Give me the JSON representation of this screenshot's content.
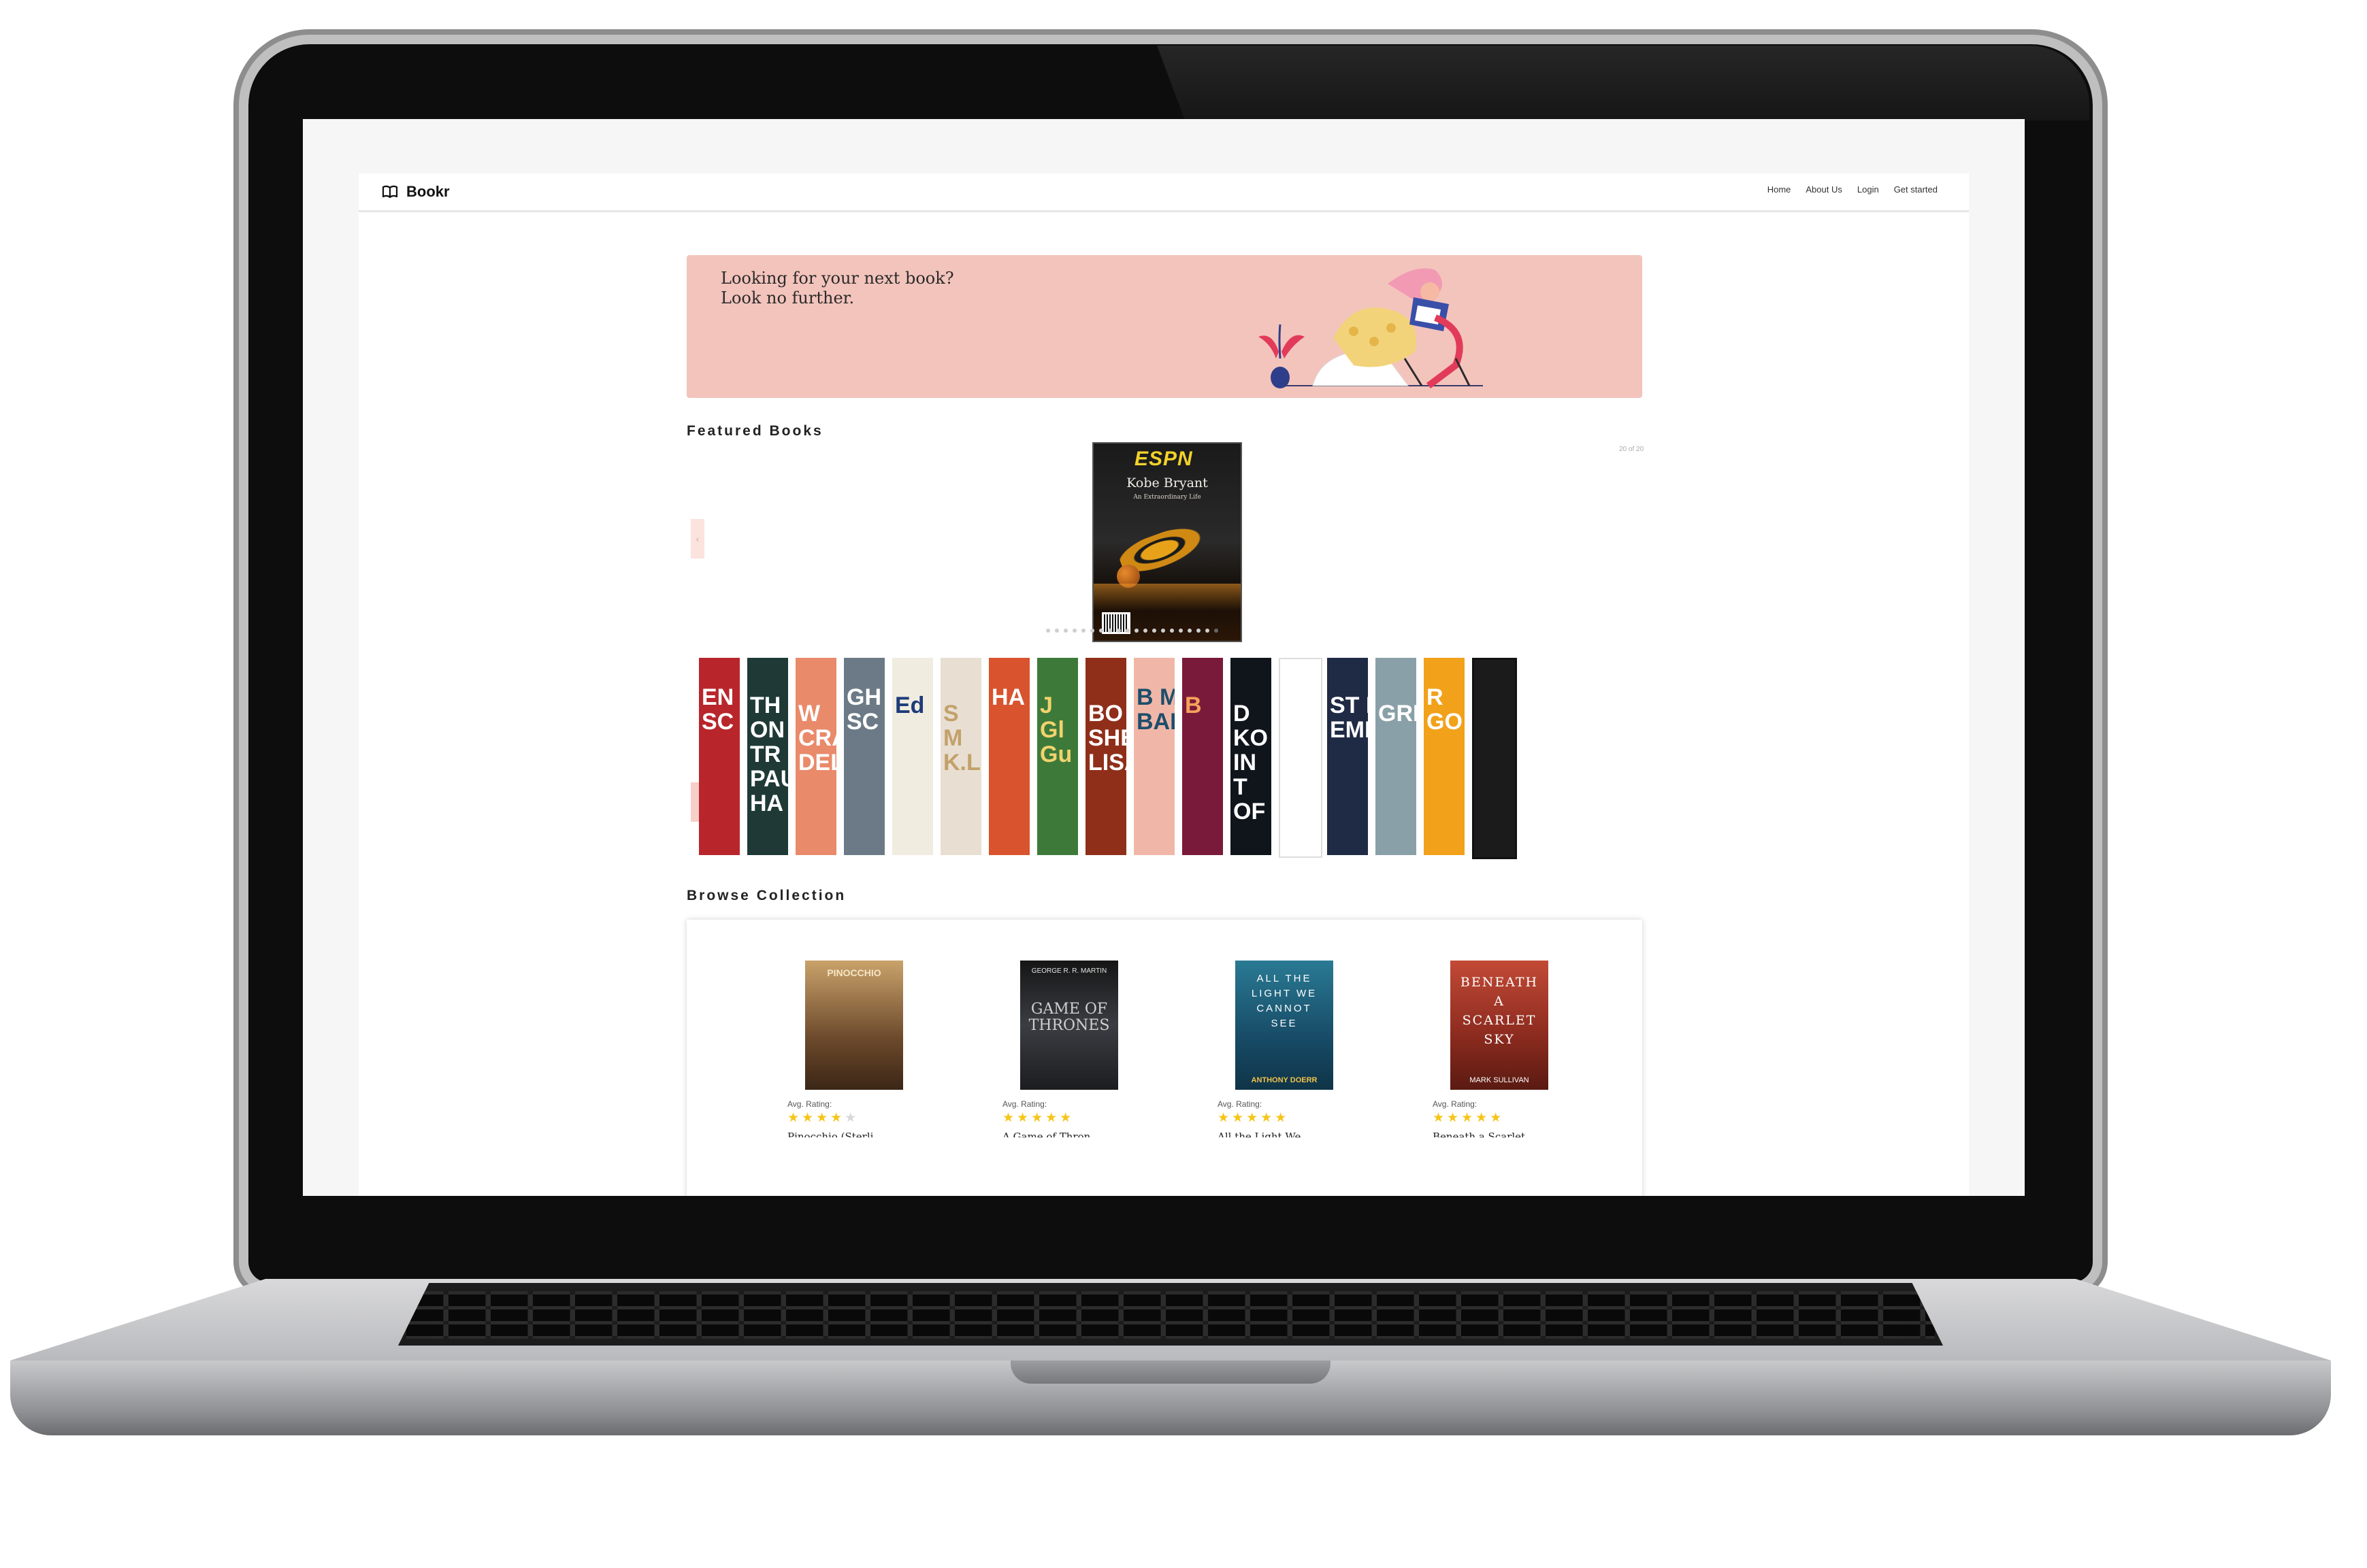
{
  "brand": {
    "name": "Bookr"
  },
  "nav": {
    "links": [
      "Home",
      "About Us",
      "Login",
      "Get started"
    ]
  },
  "hero": {
    "line1": "Looking for your next book?",
    "line2": "Look no further."
  },
  "featured": {
    "title": "Featured Books",
    "counter": "20 of 20",
    "main_cover": {
      "logo": "ESPN",
      "title": "Kobe Bryant",
      "subtitle": "An Extraordinary Life"
    },
    "prev_label": "‹",
    "thumbnails": [
      {
        "text": "EN SC",
        "bg": "#b8262b",
        "fg": "#ffffff"
      },
      {
        "text": "TH ON TR PAU HA",
        "bg": "#1f3a36",
        "fg": "#ffffff"
      },
      {
        "text": "W CRA DEL",
        "bg": "#e98a6a",
        "fg": "#ffffff"
      },
      {
        "text": "GH SC",
        "bg": "#6b7a86",
        "fg": "#ffffff"
      },
      {
        "text": "Ed",
        "bg": "#f1ece0",
        "fg": "#1c3b7a"
      },
      {
        "text": "S M K.L",
        "bg": "#e8dfd2",
        "fg": "#c3a16b"
      },
      {
        "text": "HA",
        "bg": "#d8532e",
        "fg": "#ffffff"
      },
      {
        "text": "J Gl Gu",
        "bg": "#3d7a3a",
        "fg": "#f1d36d"
      },
      {
        "text": "BO SHE LISA",
        "bg": "#8f2f1a",
        "fg": "#ffffff"
      },
      {
        "text": "B M BARB",
        "bg": "#f0b7a8",
        "fg": "#1d4e6b"
      },
      {
        "text": "B",
        "bg": "#7a1a3a",
        "fg": "#f5a35b"
      },
      {
        "text": "D KO IN T OF",
        "bg": "#10151c",
        "fg": "#ffffff"
      },
      {
        "text": "",
        "bg": "#ffffff",
        "fg": "#ffffff"
      },
      {
        "text": "ST El EMILY",
        "bg": "#1f2a44",
        "fg": "#ffffff"
      },
      {
        "text": "GRE",
        "bg": "#8aa0a8",
        "fg": "#ffffff"
      },
      {
        "text": "R GO",
        "bg": "#f2a11a",
        "fg": "#ffffff"
      },
      {
        "text": "",
        "bg": "#1b1b1b",
        "fg": "#ffffff"
      }
    ]
  },
  "browse": {
    "title": "Browse Collection",
    "books": [
      {
        "cover_title": "PINOCCHIO",
        "cover_author": "",
        "title": "Pinocchio (Sterli",
        "rating_label": "Avg. Rating:",
        "stars_on": "★★★★",
        "stars_off": "★",
        "bg": "#7a5a3a"
      },
      {
        "cover_title": "GAME OF THRONES",
        "cover_author": "GEORGE R. R. MARTIN",
        "title": "A Game of Thron",
        "rating_label": "Avg. Rating:",
        "stars_on": "★★★★★",
        "stars_off": "",
        "bg": "#2d2f33"
      },
      {
        "cover_title": "ALL THE LIGHT WE CANNOT SEE",
        "cover_author": "ANTHONY DOERR",
        "title": "All the Light We",
        "rating_label": "Avg. Rating:",
        "stars_on": "★★★★★",
        "stars_off": "",
        "bg": "#1e5f78"
      },
      {
        "cover_title": "BENEATH A SCARLET SKY",
        "cover_author": "MARK SULLIVAN",
        "title": "Beneath a Scarlet",
        "rating_label": "Avg. Rating:",
        "stars_on": "★★★★★",
        "stars_off": "",
        "bg": "#a83a2a"
      }
    ]
  },
  "colors": {
    "hero_bg": "#f3c4bc",
    "star": "#f5c518",
    "accent": "#e8a39a"
  }
}
